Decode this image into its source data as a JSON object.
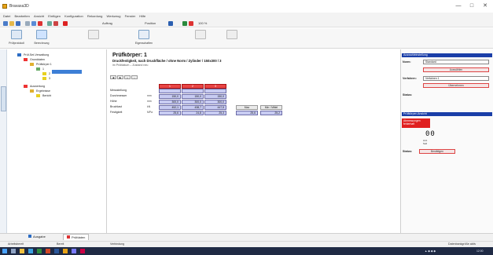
{
  "window": {
    "title": "Bravaxa3D",
    "minimize": "—",
    "maximize": "□",
    "close": "✕"
  },
  "menu": [
    "Datei",
    "Bearbeiten",
    "Ansicht",
    "Einfügen",
    "Konfiguration",
    "Rekordung",
    "Werkzeug",
    "Fenster",
    "Hilfe"
  ],
  "toolbar": {
    "dropdown": "Auftrag",
    "combo": "Position",
    "zoom": "100 %"
  },
  "ribbon": [
    {
      "label": "Prüfprotokoll"
    },
    {
      "label": "Berechnung"
    },
    {
      "label": ""
    },
    {
      "label": "Eigenschaften"
    },
    {
      "label": ""
    }
  ],
  "tree": {
    "root": "Prüf-Set-Verwaltung",
    "nodes": [
      "Grunddaten",
      "Prüfkörper 1",
      "1",
      "2",
      "3",
      "Auswertung",
      "Ergebnisse",
      "Bericht"
    ]
  },
  "main": {
    "title": "Prüfkörper: 1",
    "subtitle": "Druckfestigkeit, nach Druckfläche / ohne Norm / Zylinder / 150x300 / 3",
    "note": "im Prüfdatum – Zustand neu",
    "mini": [
      "◀",
      "▶",
      "+",
      "−"
    ],
    "col_headers": [
      "1",
      "2",
      "3"
    ],
    "rows": [
      {
        "label": "Messstellung",
        "unit": "",
        "values": [
          "",
          "",
          ""
        ]
      },
      {
        "label": "Durchmesser",
        "unit": "mm",
        "values": [
          "150,0",
          "150,0",
          "150,0"
        ]
      },
      {
        "label": "Höhe",
        "unit": "mm",
        "values": [
          "300,0",
          "300,0",
          "300,0"
        ]
      },
      {
        "label": "Bruchlast",
        "unit": "kN",
        "values": [
          "452,1",
          "438,7",
          "447,5"
        ]
      },
      {
        "label": "Festigkeit",
        "unit": "MPa",
        "values": [
          "25,6",
          "24,8",
          "25,3"
        ]
      }
    ],
    "summary": {
      "max_label": "Max",
      "min_label": "Min / Mittel",
      "max_value": "25,6",
      "mean_value": "25,2"
    }
  },
  "right_panel": {
    "section1": "Auswahleinstellung",
    "norm_label": "Norm:",
    "norm_value": "Standard",
    "norm_button": "Auswählen",
    "verfahren_label": "Verfahren:",
    "verfahren_value": "Verfahren 1",
    "verfahren_button": "Übernehmen",
    "status_label": "Status:",
    "section2": "Prüfkörper-Ansicht",
    "red_text": "Abmessungen fehlerhaft",
    "display": "00",
    "display_caption": "Anz.",
    "display_caption2": "Soll",
    "button_label": "Status:",
    "button_text": "Bestätigen"
  },
  "bottom_tabs": [
    "Ausgabe",
    "Prüfdaten"
  ],
  "status": {
    "left": "Arbeitsbereit",
    "middle1": "Bereit",
    "middle2": "Verbindung",
    "right": "Datenbankgröße aktiv"
  },
  "clock": "12:00"
}
